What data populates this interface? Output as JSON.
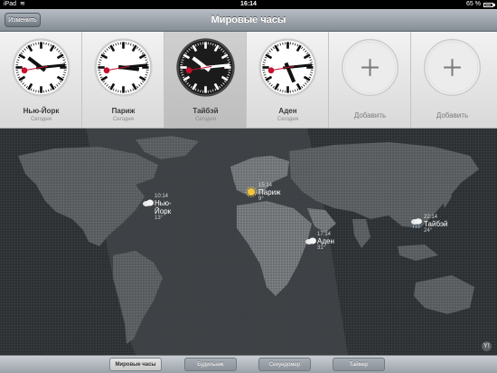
{
  "status_bar": {
    "carrier": "iPad",
    "wifi_icon": "wifi-icon",
    "time": "16:14",
    "battery": "65 %"
  },
  "nav": {
    "edit_label": "Изменить",
    "title": "Мировые часы"
  },
  "clocks": [
    {
      "city": "Нью-Йорк",
      "day": "Сегодня",
      "time": "10:14",
      "face": "light"
    },
    {
      "city": "Париж",
      "day": "Сегодня",
      "time": "15:14",
      "face": "light"
    },
    {
      "city": "Тайбэй",
      "day": "Сегодня",
      "time": "22:14",
      "face": "dark",
      "selected": true
    },
    {
      "city": "Аден",
      "day": "Сегодня",
      "time": "17:14",
      "face": "light"
    }
  ],
  "add_slots": [
    {
      "label": "Добавить"
    },
    {
      "label": "Добавить"
    }
  ],
  "map_markers": [
    {
      "city": "Нью-Йорк",
      "time": "10:14",
      "temp": "13°",
      "weather_icon": "cloud-icon"
    },
    {
      "city": "Париж",
      "time": "15:14",
      "temp": "9°",
      "weather_icon": "sun-icon"
    },
    {
      "city": "Аден",
      "time": "17:14",
      "temp": "31°",
      "weather_icon": "cloud-icon"
    },
    {
      "city": "Тайбэй",
      "time": "22:14",
      "temp": "24°",
      "weather_icon": "rain-icon"
    }
  ],
  "tabs": [
    {
      "label": "Мировые часы",
      "active": true
    },
    {
      "label": "Будильник",
      "active": false
    },
    {
      "label": "Секундомер",
      "active": false
    },
    {
      "label": "Таймер",
      "active": false
    }
  ],
  "colors": {
    "accent_red": "#c8102e",
    "nav_top": "#b7bdc4",
    "map_bg": "#35393c"
  }
}
